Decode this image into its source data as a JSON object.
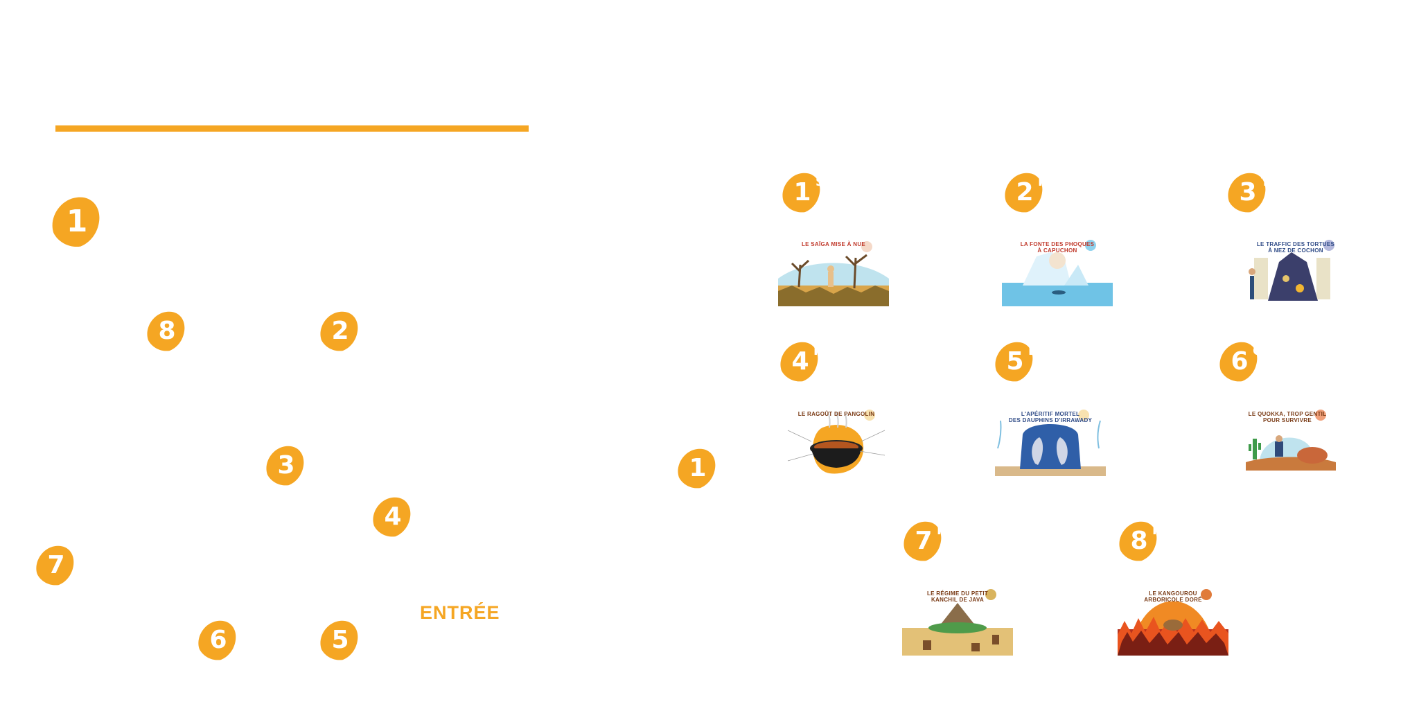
{
  "colors": {
    "accent": "#f5a623",
    "title_red": "#c0392b",
    "title_blue": "#2e4a86",
    "title_brown": "#7a3b16"
  },
  "map": {
    "entrance_label": "ENTRÉE",
    "pins": [
      {
        "number": "1"
      },
      {
        "number": "8"
      },
      {
        "number": "2"
      },
      {
        "number": "3"
      },
      {
        "number": "4"
      },
      {
        "number": "7"
      },
      {
        "number": "6"
      },
      {
        "number": "5"
      }
    ]
  },
  "stations": {
    "center_pin": "1",
    "items": [
      {
        "number": "1",
        "suffix": "S",
        "title_line1": "LE SAÏGA MISE À NUE",
        "title_line2": ""
      },
      {
        "number": "2",
        "suffix": "F",
        "title_line1": "LA FONTE DES PHOQUES",
        "title_line2": "À CAPUCHON"
      },
      {
        "number": "3",
        "suffix": "T",
        "title_line1": "LE TRAFFIC DES TORTUES",
        "title_line2": "À NEZ DE COCHON"
      },
      {
        "number": "4",
        "suffix": "P",
        "title_line1": "LE RAGOÛT DE PANGOLIN",
        "title_line2": ""
      },
      {
        "number": "5",
        "suffix": "D",
        "title_line1": "L'APÉRITIF MORTEL",
        "title_line2": "DES DAUPHINS D'IRRAWADY"
      },
      {
        "number": "6",
        "suffix": "C",
        "title_line1": "LE QUOKKA, TROP GENTIL",
        "title_line2": "POUR SURVIVRE"
      },
      {
        "number": "7",
        "suffix": "P",
        "title_line1": "LE RÉGIME DU PETIT",
        "title_line2": "KANCHIL DE JAVA"
      },
      {
        "number": "8",
        "suffix": "K",
        "title_line1": "LE KANGOUROU",
        "title_line2": "ARBORICOLE DORÉ"
      }
    ]
  }
}
